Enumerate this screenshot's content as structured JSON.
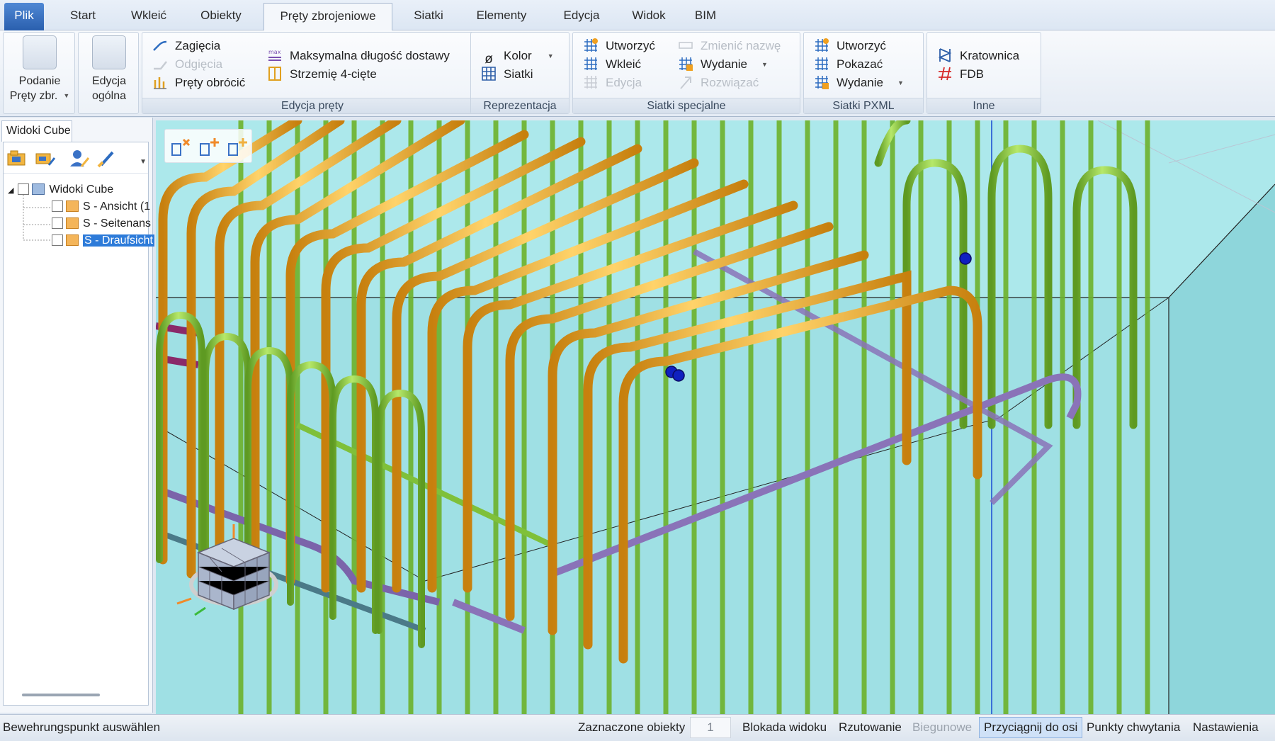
{
  "tabs": [
    "Plik",
    "Start",
    "Wkleić",
    "Obiekty",
    "Pręty zbrojeniowe",
    "Siatki",
    "Elementy",
    "Edycja",
    "Widok",
    "BIM"
  ],
  "ribbon": {
    "big_buttons": [
      {
        "line1": "Podanie",
        "line2": "Pręty zbr."
      },
      {
        "line1": "Edycja",
        "line2": "ogólna"
      }
    ],
    "edit_bars": {
      "label": "Edycja pręty",
      "items": [
        "Zagięcia",
        "Odgięcia",
        "Pręty obrócić",
        "Maksymalna długość dostawy",
        "Strzemię 4-cięte"
      ],
      "max_tag": "max"
    },
    "representation": {
      "label": "Reprezentacja",
      "items": [
        "Kolor",
        "Siatki"
      ],
      "diameter_glyph": "ø"
    },
    "special_meshes": {
      "label": "Siatki specjalne",
      "items": [
        "Utworzyć",
        "Wkleić",
        "Edycja",
        "Zmienić nazwę",
        "Wydanie",
        "Rozwiązać"
      ]
    },
    "pxml_meshes": {
      "label": "Siatki PXML",
      "items": [
        "Utworzyć",
        "Pokazać",
        "Wydanie"
      ]
    },
    "other": {
      "label": "Inne",
      "items": [
        "Kratownica",
        "FDB"
      ]
    }
  },
  "left_panel": {
    "tab": "Widoki Cube",
    "tree": {
      "root": "Widoki Cube",
      "children": [
        "S - Ansicht (1",
        "S - Seitenans",
        "S - Draufsicht"
      ]
    }
  },
  "status_bar": {
    "hint": "Bewehrungspunkt auswählen",
    "selected_label": "Zaznaczone obiekty",
    "selected_count": "1",
    "items": [
      "Blokada widoku",
      "Rzutowanie",
      "Biegunowe",
      "Przyciągnij do osi",
      "Punkty chwytania",
      "Nastawienia"
    ]
  },
  "colors": {
    "ribbon_bg": "#e4ebf4",
    "file_tab": "#2a5fae",
    "accent_selection": "#2d7bd9",
    "concrete": "#9fe2e6",
    "stirrup_orange": "#f0ad2a",
    "bar_green": "#7fc03a",
    "purple_bar": "#8a73b8",
    "marker_blue": "#1020c0"
  }
}
